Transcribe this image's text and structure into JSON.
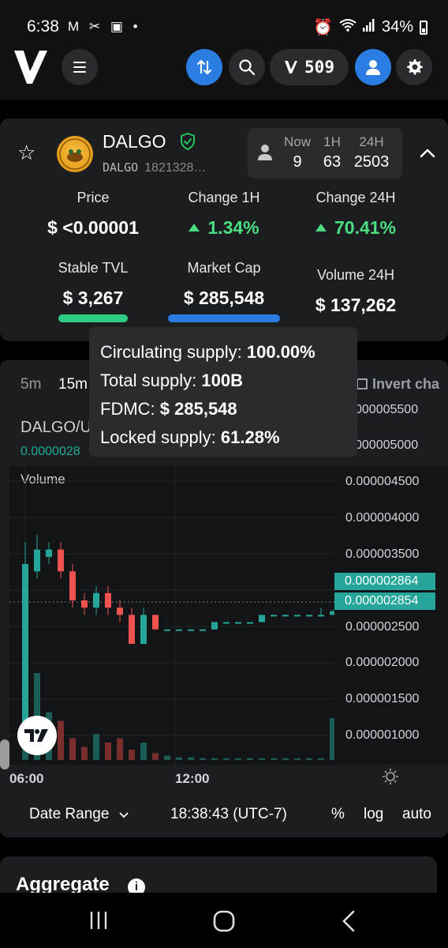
{
  "status_bar": {
    "time": "6:38",
    "battery": "34%"
  },
  "header": {
    "points_value": "509",
    "points_icon": "v-logo-icon"
  },
  "token": {
    "name": "DALGO",
    "symbol": "DALGO",
    "address": "1821328…",
    "holders": [
      {
        "label": "Now",
        "value": "9"
      },
      {
        "label": "1H",
        "value": "63"
      },
      {
        "label": "24H",
        "value": "2503"
      }
    ]
  },
  "stats": {
    "price_label": "Price",
    "price_value": "$ <0.00001",
    "change1h_label": "Change 1H",
    "change1h_value": "1.34%",
    "change24h_label": "Change 24H",
    "change24h_value": "70.41%",
    "tvl_label": "Stable TVL",
    "tvl_value": "$ 3,267",
    "mcap_label": "Market Cap",
    "mcap_value": "$ 285,548",
    "volume_label": "Volume 24H",
    "volume_value": "$ 137,262"
  },
  "tooltip": {
    "circ_label": "Circulating supply:",
    "circ_value": "100.00%",
    "total_label": "Total supply:",
    "total_value": "100B",
    "fdmc_label": "FDMC:",
    "fdmc_value": "$ 285,548",
    "locked_label": "Locked supply:",
    "locked_value": "61.28%"
  },
  "chart": {
    "timeframes": [
      "5m",
      "15m"
    ],
    "invert_label": "Invert cha",
    "pair": "DALGO/U",
    "pair_price": "0.0000028",
    "volume_label": "Volume",
    "y_ticks": [
      "000005500",
      "000005000",
      "0.000004500",
      "0.000004000",
      "0.000003500",
      "0.000002500",
      "0.000002000",
      "0.000001500",
      "0.000001000"
    ],
    "price_tag_1": "0.000002864",
    "price_tag_2": "0.000002854",
    "x_ticks": [
      "06:00",
      "12:00"
    ],
    "date_range": "Date Range",
    "clock": "18:38:43 (UTC-7)",
    "percent": "%",
    "log": "log",
    "auto": "auto"
  },
  "chart_data": {
    "type": "candlestick",
    "x_ticks": [
      "06:00",
      "12:00"
    ],
    "ylim": [
      8e-07,
      5.7e-06
    ],
    "up_color": "#26a69a",
    "down_color": "#ef5350",
    "candles": [
      {
        "o": 1.3e-06,
        "c": 3.5e-06,
        "h": 3.8e-06,
        "l": 1.2e-06
      },
      {
        "o": 3.4e-06,
        "c": 3.7e-06,
        "h": 3.9e-06,
        "l": 3.3e-06
      },
      {
        "o": 3.6e-06,
        "c": 3.7e-06,
        "h": 3.8e-06,
        "l": 3.5e-06
      },
      {
        "o": 3.7e-06,
        "c": 3.4e-06,
        "h": 3.8e-06,
        "l": 3.3e-06
      },
      {
        "o": 3.4e-06,
        "c": 3e-06,
        "h": 3.5e-06,
        "l": 2.9e-06
      },
      {
        "o": 3e-06,
        "c": 2.9e-06,
        "h": 3.1e-06,
        "l": 2.8e-06
      },
      {
        "o": 2.9e-06,
        "c": 3.1e-06,
        "h": 3.2e-06,
        "l": 2.8e-06
      },
      {
        "o": 3.1e-06,
        "c": 2.9e-06,
        "h": 3.2e-06,
        "l": 2.8e-06
      },
      {
        "o": 2.9e-06,
        "c": 2.8e-06,
        "h": 3e-06,
        "l": 2.7e-06
      },
      {
        "o": 2.8e-06,
        "c": 2.4e-06,
        "h": 2.9e-06,
        "l": 2.4e-06
      },
      {
        "o": 2.4e-06,
        "c": 2.8e-06,
        "h": 2.9e-06,
        "l": 2.4e-06
      },
      {
        "o": 2.8e-06,
        "c": 2.6e-06,
        "h": 2.8e-06,
        "l": 2.6e-06
      },
      {
        "o": 2.6e-06,
        "c": 2.6e-06,
        "h": 2.6e-06,
        "l": 2.6e-06
      },
      {
        "o": 2.6e-06,
        "c": 2.6e-06,
        "h": 2.6e-06,
        "l": 2.6e-06
      },
      {
        "o": 2.6e-06,
        "c": 2.6e-06,
        "h": 2.6e-06,
        "l": 2.6e-06
      },
      {
        "o": 2.6e-06,
        "c": 2.6e-06,
        "h": 2.6e-06,
        "l": 2.6e-06
      },
      {
        "o": 2.6e-06,
        "c": 2.7e-06,
        "h": 2.7e-06,
        "l": 2.6e-06
      },
      {
        "o": 2.7e-06,
        "c": 2.7e-06,
        "h": 2.7e-06,
        "l": 2.7e-06
      },
      {
        "o": 2.7e-06,
        "c": 2.7e-06,
        "h": 2.7e-06,
        "l": 2.7e-06
      },
      {
        "o": 2.7e-06,
        "c": 2.7e-06,
        "h": 2.7e-06,
        "l": 2.7e-06
      },
      {
        "o": 2.7e-06,
        "c": 2.8e-06,
        "h": 2.8e-06,
        "l": 2.7e-06
      },
      {
        "o": 2.8e-06,
        "c": 2.8e-06,
        "h": 2.8e-06,
        "l": 2.8e-06
      },
      {
        "o": 2.8e-06,
        "c": 2.8e-06,
        "h": 2.8e-06,
        "l": 2.8e-06
      },
      {
        "o": 2.8e-06,
        "c": 2.8e-06,
        "h": 2.8e-06,
        "l": 2.8e-06
      },
      {
        "o": 2.8e-06,
        "c": 2.8e-06,
        "h": 2.8e-06,
        "l": 2.8e-06
      },
      {
        "o": 2.8e-06,
        "c": 2.8e-06,
        "h": 2.9e-06,
        "l": 2.8e-06
      },
      {
        "o": 2.8e-06,
        "c": 2.85e-06,
        "h": 2.87e-06,
        "l": 2.8e-06
      }
    ],
    "volumes_relative": [
      0.3,
      1.0,
      0.55,
      0.45,
      0.25,
      0.15,
      0.3,
      0.2,
      0.25,
      0.12,
      0.2,
      0.08,
      0.05,
      0.03,
      0.03,
      0.02,
      0.02,
      0.02,
      0.02,
      0.02,
      0.02,
      0.02,
      0.02,
      0.02,
      0.02,
      0.02,
      0.48
    ]
  },
  "aggregate": {
    "title": "Aggregate",
    "info_icon": "info-icon"
  }
}
